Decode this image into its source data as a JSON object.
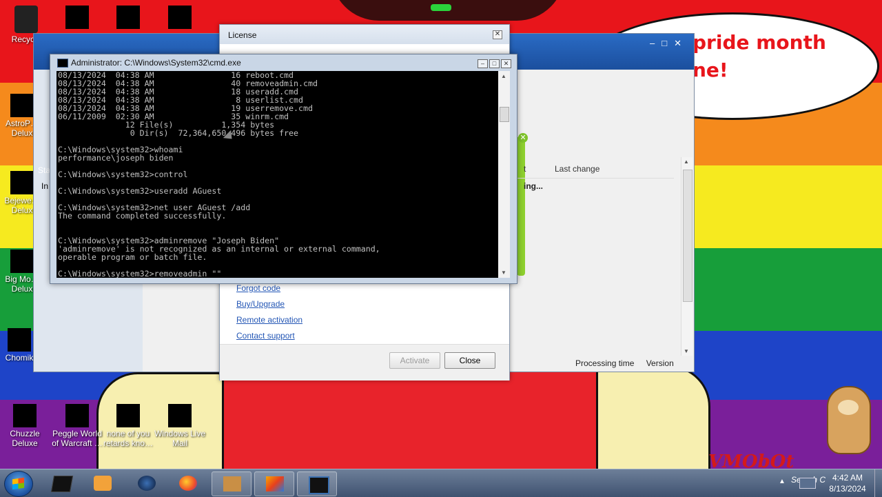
{
  "wallpaper": {
    "bubble_line1": "pride month",
    "bubble_line2": "ne!",
    "watermark": "VMObOt"
  },
  "desktop_icons": [
    {
      "label": "Recycle",
      "icon": "recycle-bin-icon"
    },
    {
      "label": "AstroP… Delux",
      "icon": "game-icon"
    },
    {
      "label": "Bejewe… Delux",
      "icon": "game-icon"
    },
    {
      "label": "Big Mo… Delux",
      "icon": "game-icon"
    },
    {
      "label": "Chomik",
      "icon": "hamster-icon"
    },
    {
      "label": "Chuzzle Deluxe",
      "icon": "game-icon"
    },
    {
      "label": "Peggle World of Warcraft …",
      "icon": "game-icon"
    },
    {
      "label": "none of you retards kno…",
      "icon": "game-icon"
    },
    {
      "label": "Windows Live Mail",
      "icon": "mail-icon"
    }
  ],
  "bg_window": {
    "sta": "Sta",
    "ins": "In",
    "col_partial": "t",
    "last_change": "Last change",
    "loading": "ing...",
    "status_processing": "Processing time",
    "status_version": "Version"
  },
  "license": {
    "title": "License",
    "links": [
      "Forgot code",
      "Buy/Upgrade",
      "Remote activation",
      "Contact support"
    ],
    "activate": "Activate",
    "close": "Close"
  },
  "cmd": {
    "title": "Administrator: C:\\Windows\\System32\\cmd.exe",
    "lines": [
      "08/13/2024  04:38 AM                16 reboot.cmd",
      "08/13/2024  04:38 AM                40 removeadmin.cmd",
      "08/13/2024  04:38 AM                18 useradd.cmd",
      "08/13/2024  04:38 AM                 8 userlist.cmd",
      "08/13/2024  04:38 AM                19 userremove.cmd",
      "06/11/2009  02:30 AM                35 winrm.cmd",
      "              12 File(s)          1,354 bytes",
      "               0 Dir(s)  72,364,650,496 bytes free",
      "",
      "C:\\Windows\\system32>whoami",
      "performance\\joseph biden",
      "",
      "C:\\Windows\\system32>control",
      "",
      "C:\\Windows\\system32>useradd AGuest",
      "",
      "C:\\Windows\\system32>net user AGuest /add",
      "The command completed successfully.",
      "",
      "",
      "C:\\Windows\\system32>adminremove \"Joseph Biden\"",
      "'adminremove' is not recognized as an internal or external command,",
      "operable program or batch file.",
      "",
      "C:\\Windows\\system32>removeadmin \"\"_"
    ]
  },
  "taskbar": {
    "items": [
      "terminal-icon",
      "media-player-icon",
      "globe-icon",
      "firefox-icon",
      "hamster-box-icon",
      "paint-icon",
      "cmd-icon"
    ],
    "search": "Search C",
    "time": "4:42 AM",
    "date": "8/13/2024"
  }
}
